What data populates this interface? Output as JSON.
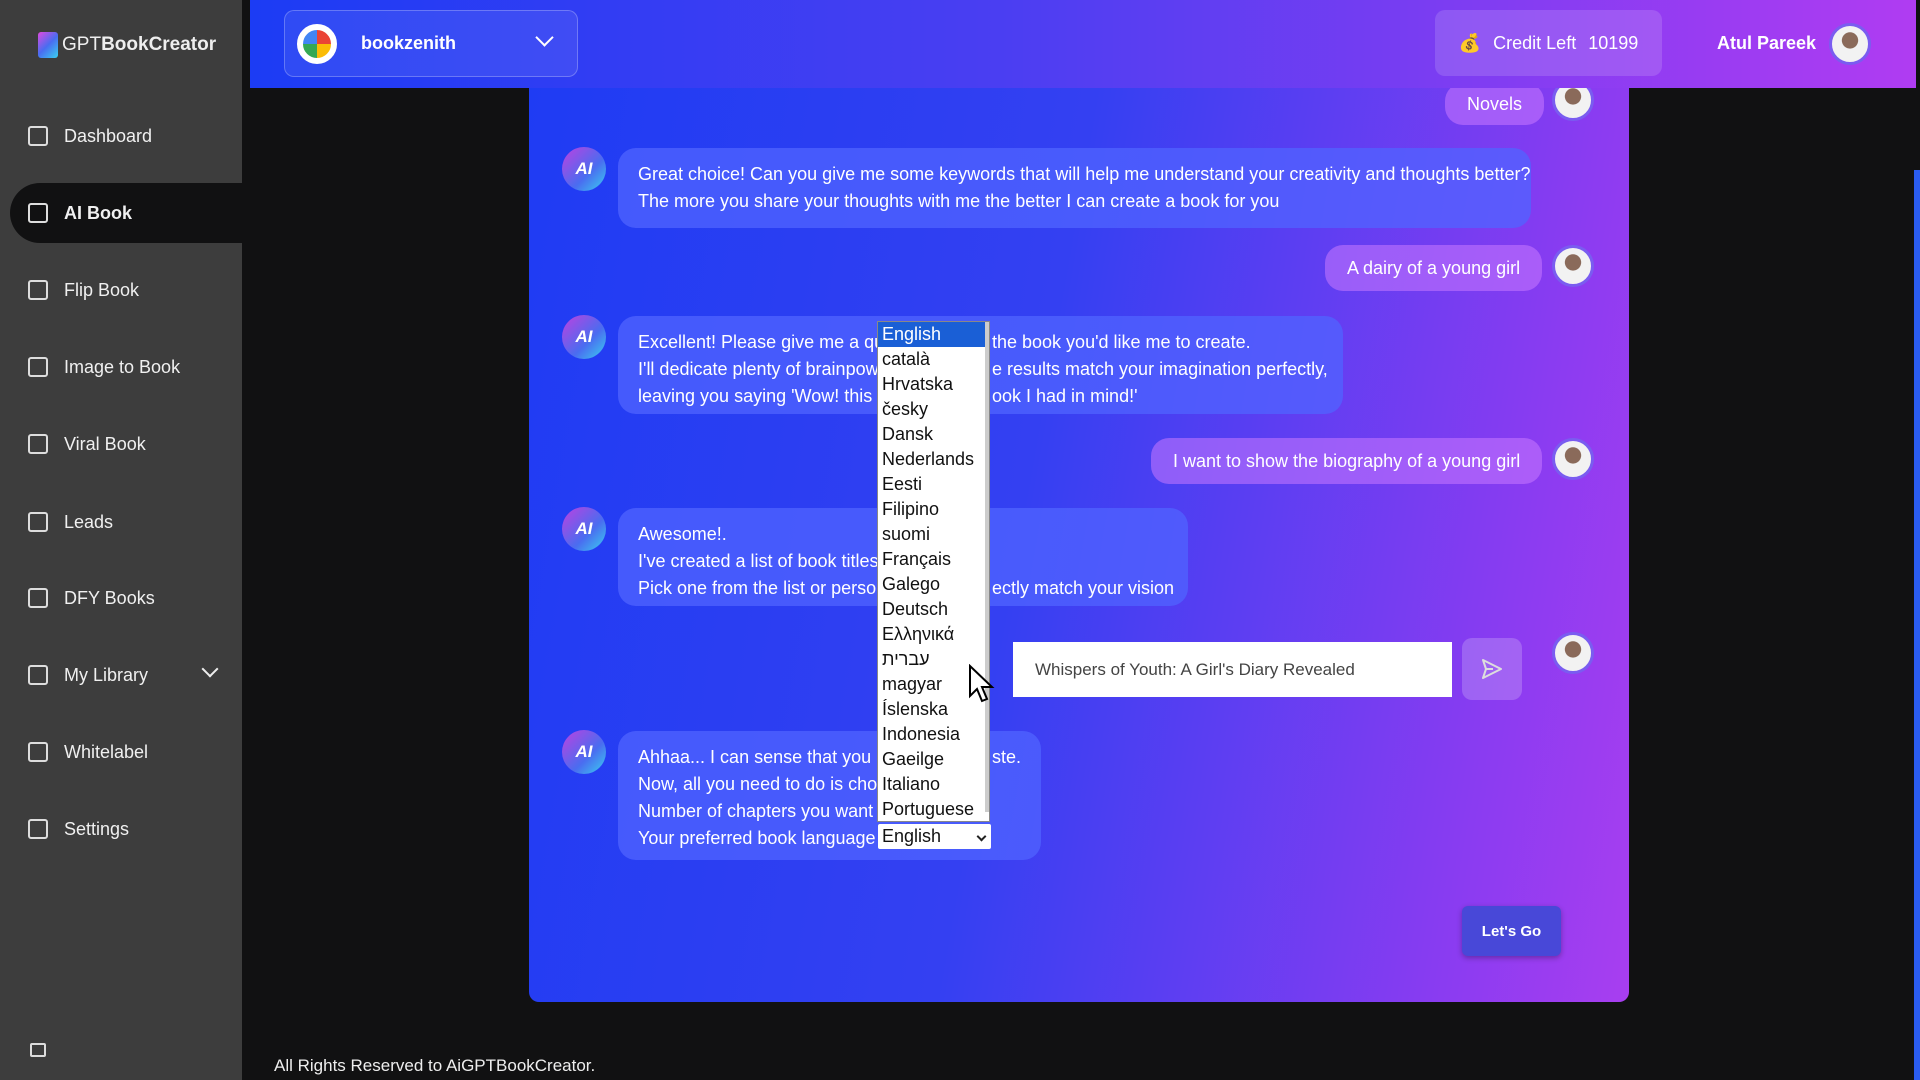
{
  "app": {
    "logo_prefix": "GPT",
    "logo_bold": "BookCreator"
  },
  "sidebar": {
    "items": [
      {
        "label": "Dashboard",
        "icon": "dashboard-icon"
      },
      {
        "label": "AI Book",
        "icon": "book-icon",
        "active": true
      },
      {
        "label": "Flip Book",
        "icon": "open-book-icon"
      },
      {
        "label": "Image to Book",
        "icon": "image-book-icon"
      },
      {
        "label": "Viral Book",
        "icon": "gift-icon"
      },
      {
        "label": "Leads",
        "icon": "leads-icon"
      },
      {
        "label": "DFY Books",
        "icon": "books-stack-icon"
      },
      {
        "label": "My Library",
        "icon": "library-icon"
      },
      {
        "label": "Whitelabel",
        "icon": "badge-icon"
      },
      {
        "label": "Settings",
        "icon": "gear-icon"
      }
    ]
  },
  "header": {
    "workspace": "bookzenith",
    "credit_label": "Credit Left",
    "credit_value": "10199",
    "user_name": "Atul Pareek"
  },
  "chat": {
    "user1": "Novels",
    "bot1": [
      "Great choice! Can you give me some keywords that will help me understand your creativity and thoughts better?",
      "The more you share your thoughts with me the better I can create a book for you"
    ],
    "user2": "A dairy of a young girl",
    "bot2": [
      [
        "Excellent! Please give me a qui",
        "the book you'd like me to create."
      ],
      [
        "I'll dedicate plenty of brainpow",
        "e results match your imagination perfectly,"
      ],
      [
        "leaving you saying 'Wow! this i",
        "ook I had in mind!'"
      ]
    ],
    "user3": "I want to show the biography of a young girl",
    "bot3": [
      [
        "Awesome!.",
        ""
      ],
      [
        "I've created a list of book titles",
        ""
      ],
      [
        "Pick one from the list or persor",
        "ectly match your vision"
      ]
    ],
    "title_input": "Whispers of Youth: A Girl's Diary Revealed",
    "bot4": [
      [
        "Ahhaa... I can sense that you ha",
        "ste."
      ],
      [
        "Now, all you need to do is cho",
        ""
      ],
      [
        "Number of chapters you want",
        ""
      ],
      [
        "Your preferred book language",
        ""
      ]
    ],
    "language_selected": "English",
    "lets_go": "Let's Go"
  },
  "language_options": [
    "English",
    "català",
    "Hrvatska",
    "česky",
    "Dansk",
    "Nederlands",
    "Eesti",
    "Filipino",
    "suomi",
    "Français",
    "Galego",
    "Deutsch",
    "Ελληνικά",
    "עברית",
    "magyar",
    "Íslenska",
    "Indonesia",
    "Gaeilge",
    "Italiano",
    "Portuguese"
  ],
  "footer": "All Rights Reserved to AiGPTBookCreator."
}
